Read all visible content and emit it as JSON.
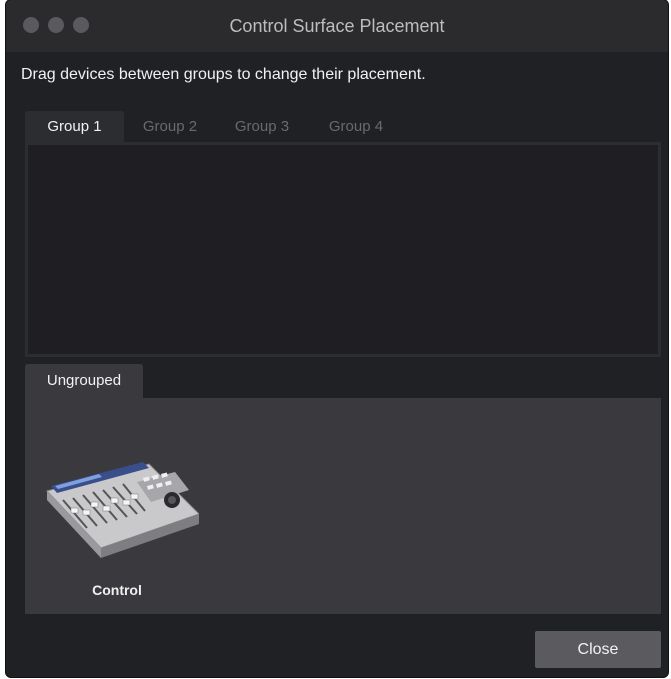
{
  "window": {
    "title": "Control Surface Placement"
  },
  "instructions": "Drag devices between groups to change their placement.",
  "tabs": [
    {
      "label": "Group 1",
      "active": true
    },
    {
      "label": "Group 2",
      "active": false
    },
    {
      "label": "Group 3",
      "active": false
    },
    {
      "label": "Group 4",
      "active": false
    }
  ],
  "ungrouped": {
    "label": "Ungrouped",
    "devices": [
      {
        "label": "Control",
        "icon": "control-surface-device-icon"
      }
    ]
  },
  "buttons": {
    "close_label": "Close"
  },
  "colors": {
    "window_bg": "#202124",
    "titlebar_bg": "#2b2b2e",
    "panel_bg": "#3a3a3e",
    "button_bg": "#5b5b5f"
  }
}
